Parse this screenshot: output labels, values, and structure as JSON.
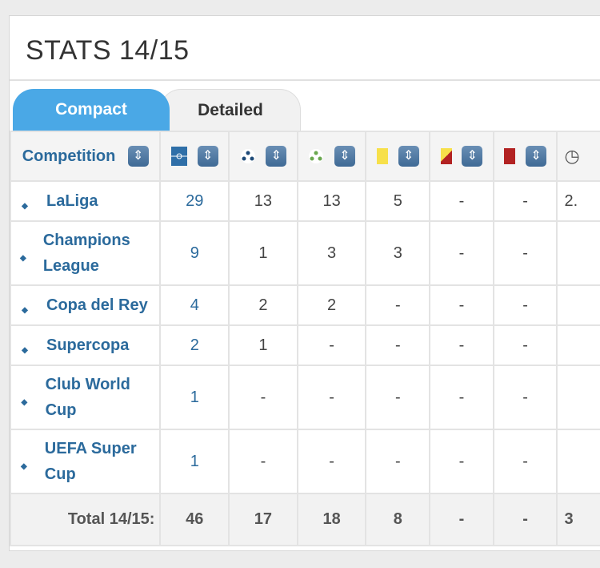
{
  "title": "STATS 14/15",
  "tabs": [
    {
      "label": "Compact",
      "active": true
    },
    {
      "label": "Detailed",
      "active": false
    }
  ],
  "header": {
    "competition": "Competition",
    "columns": [
      "pitch-icon",
      "ball-icon",
      "ball-green-icon",
      "yellow-card-icon",
      "yellow-red-card-icon",
      "red-card-icon",
      "clock-icon"
    ]
  },
  "colors": {
    "accent": "#4aa8e6",
    "link": "#2b6a9c",
    "yellow": "#f7e04a",
    "red": "#b22222"
  },
  "rows": [
    {
      "name": "LaLiga",
      "values": [
        "29",
        "13",
        "13",
        "5",
        "-",
        "-",
        "2."
      ]
    },
    {
      "name": "Champions League",
      "values": [
        "9",
        "1",
        "3",
        "3",
        "-",
        "-",
        ""
      ]
    },
    {
      "name": "Copa del Rey",
      "values": [
        "4",
        "2",
        "2",
        "-",
        "-",
        "-",
        ""
      ]
    },
    {
      "name": "Supercopa",
      "values": [
        "2",
        "1",
        "-",
        "-",
        "-",
        "-",
        ""
      ]
    },
    {
      "name": "Club World Cup",
      "values": [
        "1",
        "-",
        "-",
        "-",
        "-",
        "-",
        ""
      ]
    },
    {
      "name": "UEFA Super Cup",
      "values": [
        "1",
        "-",
        "-",
        "-",
        "-",
        "-",
        ""
      ]
    }
  ],
  "total": {
    "label": "Total 14/15:",
    "values": [
      "46",
      "17",
      "18",
      "8",
      "-",
      "-",
      "3"
    ]
  }
}
